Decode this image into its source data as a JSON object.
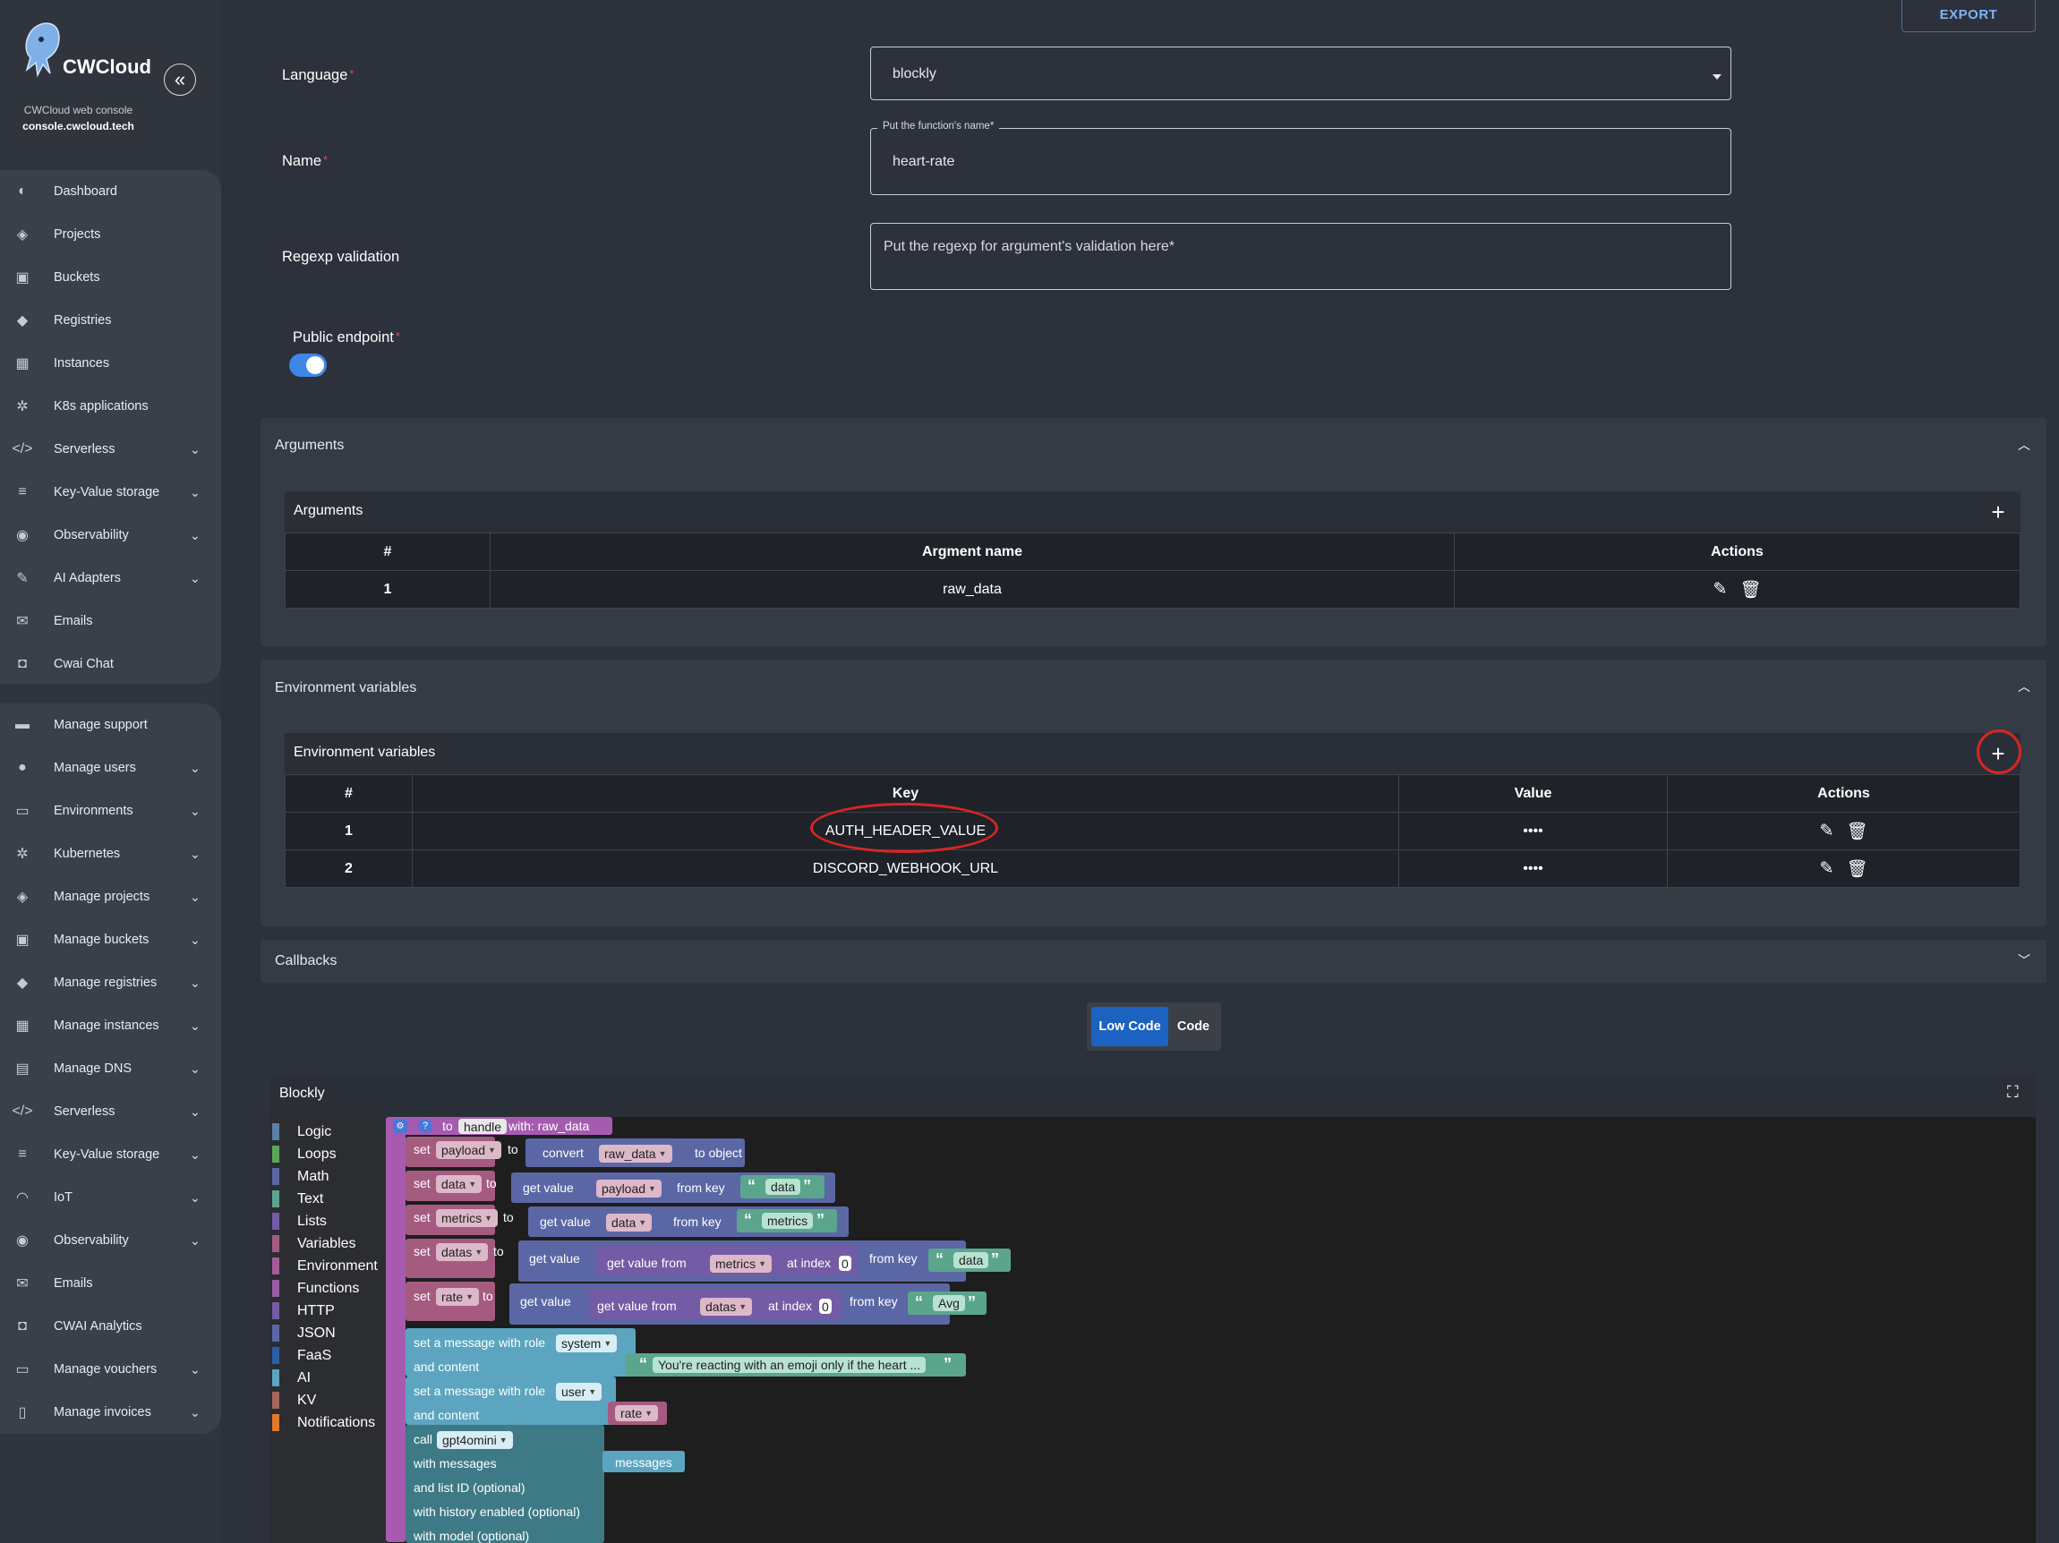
{
  "brand": {
    "name": "CWCloud",
    "subtitle": "CWCloud web console",
    "domain": "console.cwcloud.tech",
    "collapse_icon": "«"
  },
  "sidebar": {
    "group1": [
      {
        "label": "Dashboard",
        "icon": "dashboard-icon",
        "glyph": "◐",
        "chevron": false
      },
      {
        "label": "Projects",
        "icon": "layers-icon",
        "glyph": "◈",
        "chevron": false
      },
      {
        "label": "Buckets",
        "icon": "box-icon",
        "glyph": "▣",
        "chevron": false
      },
      {
        "label": "Registries",
        "icon": "docker-icon",
        "glyph": "◆",
        "chevron": false
      },
      {
        "label": "Instances",
        "icon": "chip-icon",
        "glyph": "▦",
        "chevron": false
      },
      {
        "label": "K8s applications",
        "icon": "helm-icon",
        "glyph": "✲",
        "chevron": false
      },
      {
        "label": "Serverless",
        "icon": "code-icon",
        "glyph": "</>",
        "chevron": true
      },
      {
        "label": "Key-Value storage",
        "icon": "database-icon",
        "glyph": "≡",
        "chevron": true
      },
      {
        "label": "Observability",
        "icon": "eye-icon",
        "glyph": "◉",
        "chevron": true
      },
      {
        "label": "AI Adapters",
        "icon": "magic-wand-icon",
        "glyph": "✎",
        "chevron": true
      },
      {
        "label": "Emails",
        "icon": "mail-icon",
        "glyph": "✉",
        "chevron": false
      },
      {
        "label": "Cwai Chat",
        "icon": "robot-icon",
        "glyph": "◘",
        "chevron": false
      }
    ],
    "group2": [
      {
        "label": "Manage support",
        "icon": "chat-icon",
        "glyph": "▬",
        "chevron": false
      },
      {
        "label": "Manage users",
        "icon": "users-icon",
        "glyph": "●",
        "chevron": true
      },
      {
        "label": "Environments",
        "icon": "monitor-icon",
        "glyph": "▭",
        "chevron": true
      },
      {
        "label": "Kubernetes",
        "icon": "helm-icon",
        "glyph": "✲",
        "chevron": true
      },
      {
        "label": "Manage projects",
        "icon": "layers-icon",
        "glyph": "◈",
        "chevron": true
      },
      {
        "label": "Manage buckets",
        "icon": "box-icon",
        "glyph": "▣",
        "chevron": true
      },
      {
        "label": "Manage registries",
        "icon": "docker-icon",
        "glyph": "◆",
        "chevron": true
      },
      {
        "label": "Manage instances",
        "icon": "chip-icon",
        "glyph": "▦",
        "chevron": true
      },
      {
        "label": "Manage DNS",
        "icon": "server-icon",
        "glyph": "▤",
        "chevron": true
      },
      {
        "label": "Serverless",
        "icon": "code-icon",
        "glyph": "</>",
        "chevron": true
      },
      {
        "label": "Key-Value storage",
        "icon": "database-icon",
        "glyph": "≡",
        "chevron": true
      },
      {
        "label": "IoT",
        "icon": "wifi-icon",
        "glyph": "◠",
        "chevron": true
      },
      {
        "label": "Observability",
        "icon": "eye-icon",
        "glyph": "◉",
        "chevron": true
      },
      {
        "label": "Emails",
        "icon": "mail-icon",
        "glyph": "✉",
        "chevron": false
      },
      {
        "label": "CWAI Analytics",
        "icon": "robot-icon",
        "glyph": "◘",
        "chevron": false
      },
      {
        "label": "Manage vouchers",
        "icon": "voucher-icon",
        "glyph": "▭",
        "chevron": true
      },
      {
        "label": "Manage invoices",
        "icon": "invoice-icon",
        "glyph": "▯",
        "chevron": true
      }
    ],
    "chevron_glyph": "⌄"
  },
  "header": {
    "export_label": "EXPORT"
  },
  "form": {
    "language_label": "Language",
    "language_value": "blockly",
    "name_label": "Name",
    "name_legend": "Put the function's name*",
    "name_value": "heart-rate",
    "regexp_label": "Regexp validation",
    "regexp_placeholder": "Put the regexp for argument's validation here*",
    "public_label": "Public endpoint",
    "public_enabled": true,
    "required_mark": "*"
  },
  "arguments": {
    "panel_title": "Arguments",
    "table_title": "Arguments",
    "headers": [
      "#",
      "Argment name",
      "Actions"
    ],
    "rows": [
      {
        "num": "1",
        "name": "raw_data"
      }
    ]
  },
  "env": {
    "panel_title": "Environment variables",
    "table_title": "Environment variables",
    "headers": [
      "#",
      "Key",
      "Value",
      "Actions"
    ],
    "rows": [
      {
        "num": "1",
        "key": "AUTH_HEADER_VALUE",
        "value": "••••"
      },
      {
        "num": "2",
        "key": "DISCORD_WEBHOOK_URL",
        "value": "••••"
      }
    ]
  },
  "callbacks": {
    "panel_title": "Callbacks"
  },
  "mode": {
    "low_code": "Low Code",
    "code": "Code"
  },
  "blockly": {
    "title": "Blockly",
    "toolbox": [
      {
        "label": "Logic",
        "color": "#5b80a5"
      },
      {
        "label": "Loops",
        "color": "#5ba55b"
      },
      {
        "label": "Math",
        "color": "#5b67a5"
      },
      {
        "label": "Text",
        "color": "#5ba58c"
      },
      {
        "label": "Lists",
        "color": "#745ba5"
      },
      {
        "label": "Variables",
        "color": "#a55b80"
      },
      {
        "label": "Environment",
        "color": "#a55b99"
      },
      {
        "label": "Functions",
        "color": "#995ba5"
      },
      {
        "label": "HTTP",
        "color": "#745ba5"
      },
      {
        "label": "JSON",
        "color": "#5b67a5"
      },
      {
        "label": "FaaS",
        "color": "#2a5fa5"
      },
      {
        "label": "AI",
        "color": "#5ba5c0"
      },
      {
        "label": "KV",
        "color": "#a5665b"
      },
      {
        "label": "Notifications",
        "color": "#e07b2a"
      }
    ],
    "blocks": {
      "to": "to",
      "handle": "handle",
      "with": "with: raw_data",
      "set": "set",
      "to_kw": "to",
      "payload": "payload",
      "convert": "convert",
      "raw_data": "raw_data",
      "to_object": "to object",
      "data": "data",
      "get_value": "get value",
      "from_key": "from key",
      "metrics": "metrics",
      "datas": "datas",
      "get_value_from": "get value from",
      "at_index": "at index",
      "index0": "0",
      "rate": "rate",
      "avg": "Avg",
      "msg_role": "set a message with role",
      "system": "system",
      "and_content": "and content",
      "system_text": "You're reacting with an emoji only if the heart ...",
      "user": "user",
      "call": "call",
      "gpt": "gpt4omini",
      "with_messages": "with messages",
      "messages": "messages",
      "list_id": "and list ID (optional)",
      "history": "with history enabled (optional)",
      "model": "with model (optional)",
      "open_quote": "“",
      "close_quote": "”"
    }
  }
}
